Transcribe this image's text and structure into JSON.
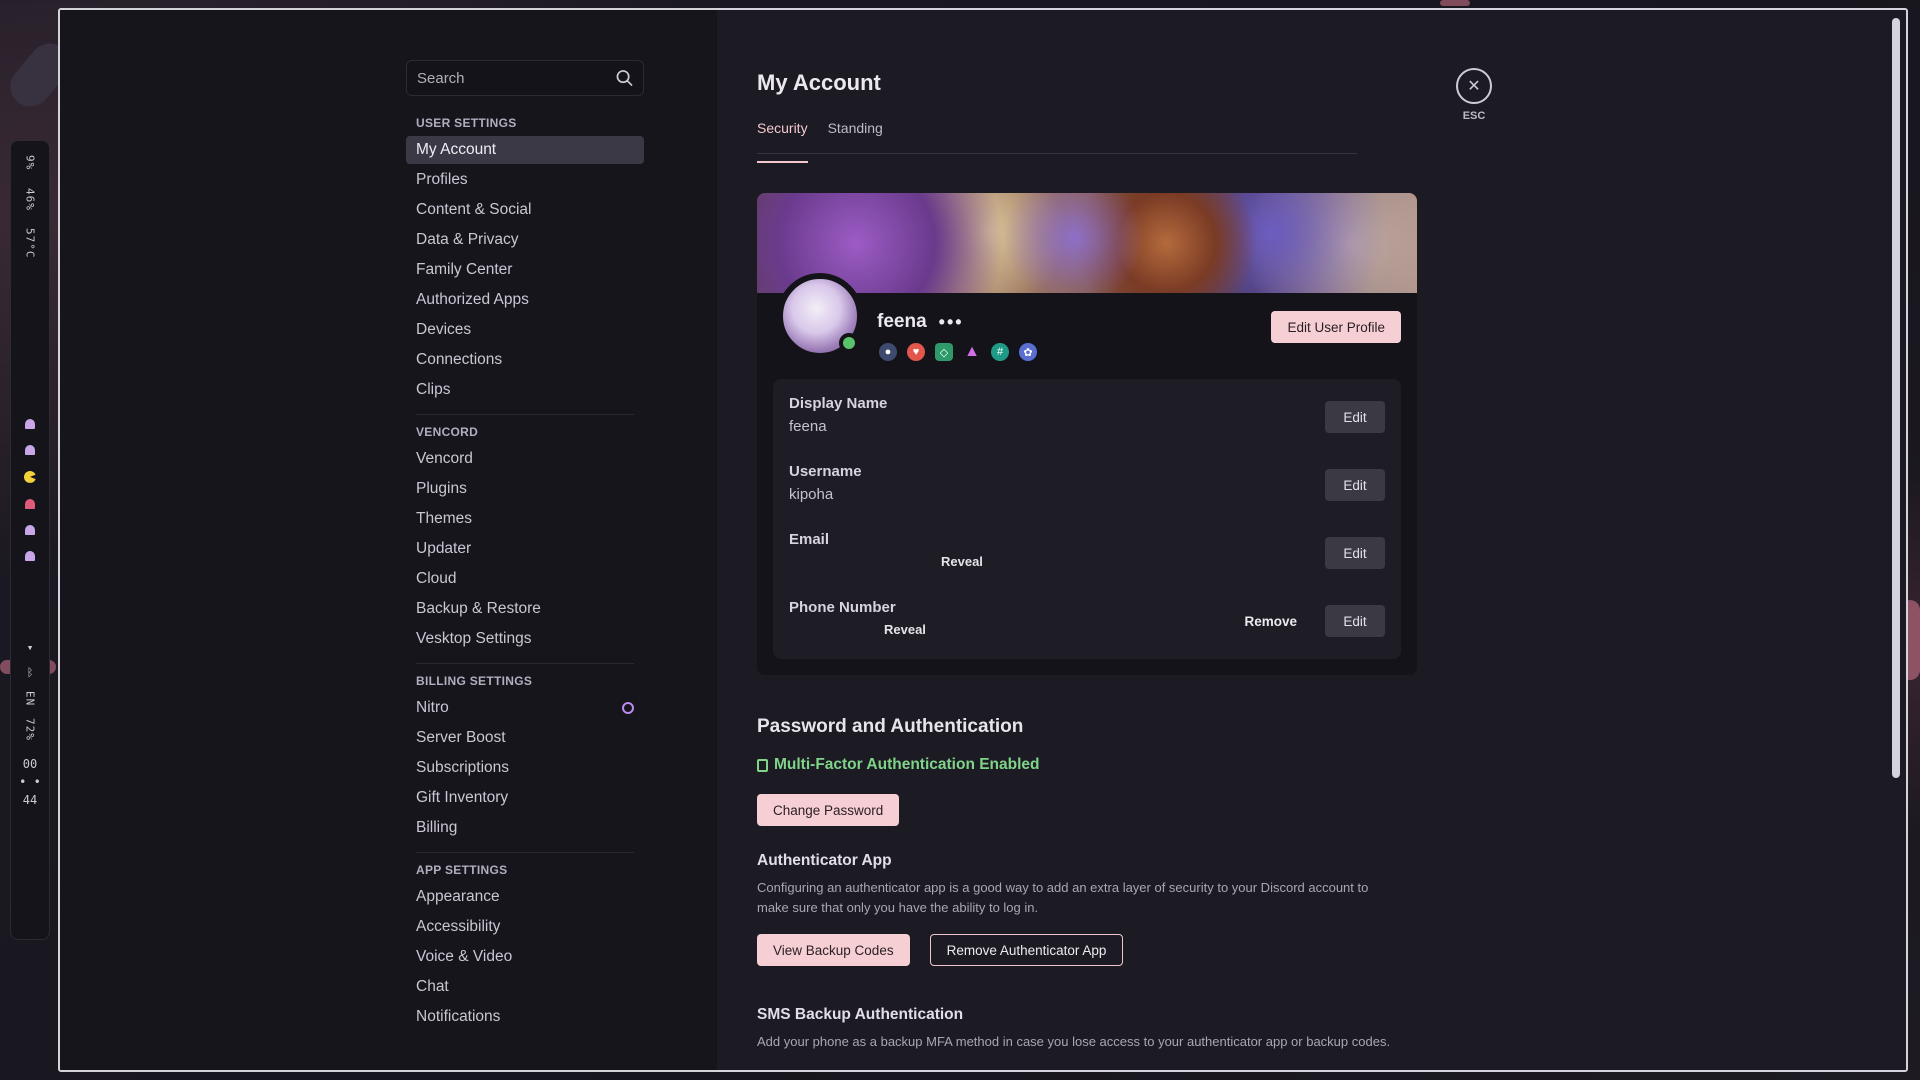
{
  "system": {
    "cpu": "9%",
    "mem": "46%",
    "temp": "57°C",
    "lang": "EN",
    "battery": "72%",
    "clock_hour": "00",
    "clock_min": "44"
  },
  "search": {
    "placeholder": "Search"
  },
  "sidebar": {
    "user_settings_title": "USER SETTINGS",
    "user_settings": [
      "My Account",
      "Profiles",
      "Content & Social",
      "Data & Privacy",
      "Family Center",
      "Authorized Apps",
      "Devices",
      "Connections",
      "Clips"
    ],
    "vencord_title": "VENCORD",
    "vencord": [
      "Vencord",
      "Plugins",
      "Themes",
      "Updater",
      "Cloud",
      "Backup & Restore",
      "Vesktop Settings"
    ],
    "billing_title": "BILLING SETTINGS",
    "billing": [
      "Nitro",
      "Server Boost",
      "Subscriptions",
      "Gift Inventory",
      "Billing"
    ],
    "app_title": "APP SETTINGS",
    "app": [
      "Appearance",
      "Accessibility",
      "Voice & Video",
      "Chat",
      "Notifications"
    ]
  },
  "main": {
    "title": "My Account",
    "tabs": [
      "Security",
      "Standing"
    ],
    "esc_label": "ESC",
    "profile": {
      "username": "feena",
      "more": "•••",
      "edit_profile": "Edit User Profile",
      "fields": {
        "display_name_label": "Display Name",
        "display_name_value": "feena",
        "username_label": "Username",
        "username_value": "kipoha",
        "email_label": "Email",
        "email_reveal": "Reveal",
        "phone_label": "Phone Number",
        "phone_reveal": "Reveal",
        "edit": "Edit",
        "remove": "Remove"
      }
    },
    "auth": {
      "title": "Password and Authentication",
      "mfa_status": "Multi-Factor Authentication Enabled",
      "change_password": "Change Password",
      "app_title": "Authenticator App",
      "app_desc": "Configuring an authenticator app is a good way to add an extra layer of security to your Discord account to make sure that only you have the ability to log in.",
      "view_backup": "View Backup Codes",
      "remove_app": "Remove Authenticator App",
      "sms_title": "SMS Backup Authentication",
      "sms_desc": "Add your phone as a backup MFA method in case you lose access to your authenticator app or backup codes."
    }
  }
}
